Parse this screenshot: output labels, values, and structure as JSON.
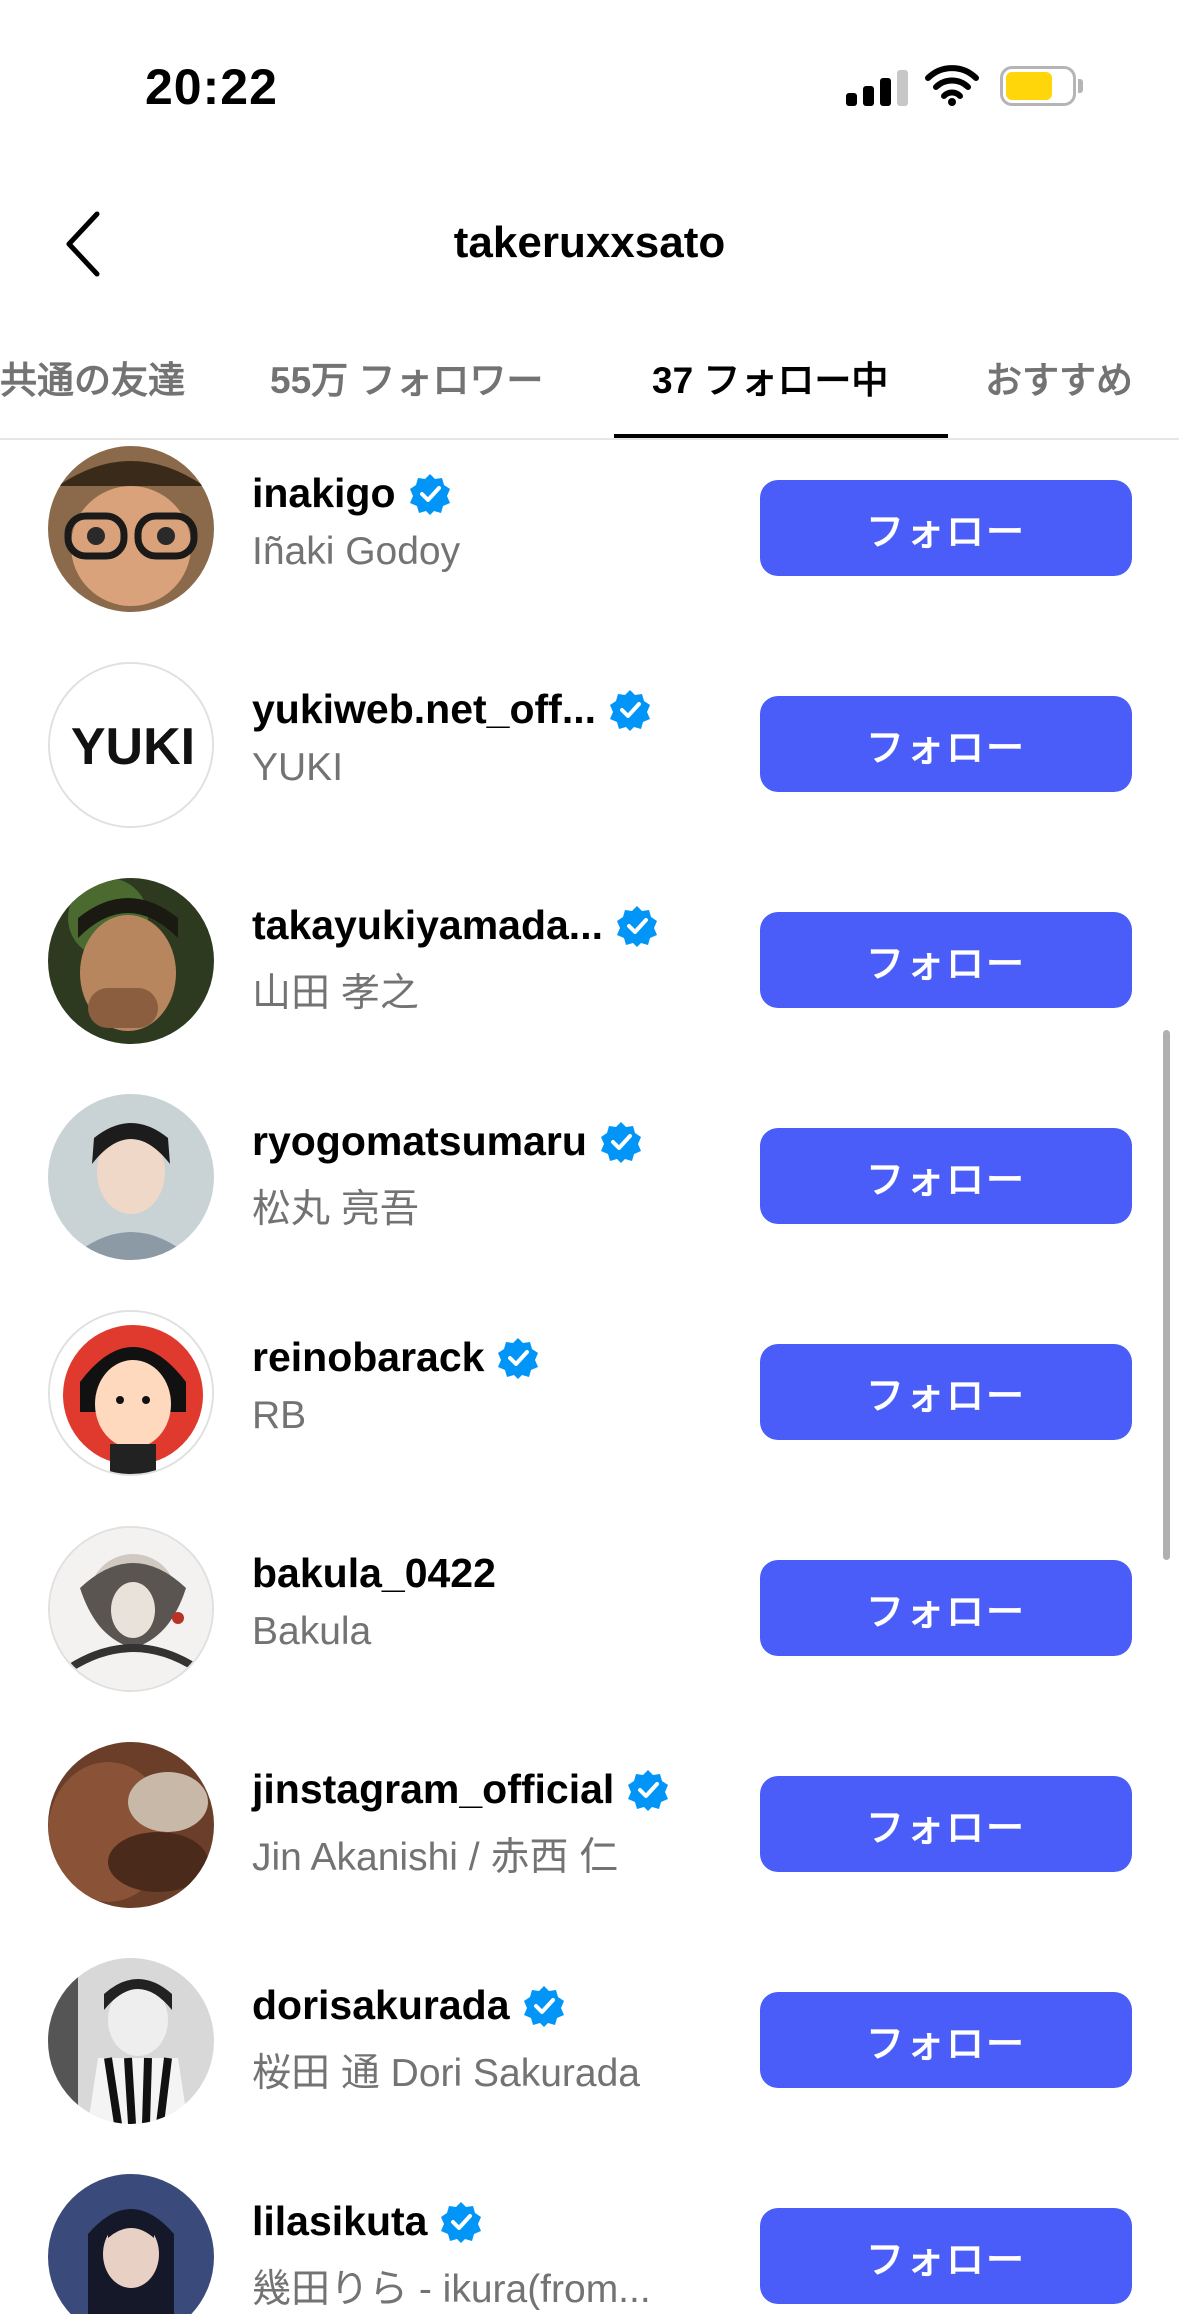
{
  "status_bar": {
    "time": "20:22"
  },
  "header": {
    "title": "takeruxxsato"
  },
  "tabs": [
    {
      "label": "共通の友達"
    },
    {
      "label": "55万 フォロワー"
    },
    {
      "label": "37 フォロー中"
    },
    {
      "label": "おすすめ"
    }
  ],
  "colors": {
    "accent": "#4a5df9",
    "verified": "#0095f6",
    "secondary_text": "#737373"
  },
  "follow_label": "フォロー",
  "accounts": [
    {
      "username": "inakigo",
      "name": "Iñaki Godoy",
      "verified": true
    },
    {
      "username": "yukiweb.net_off...",
      "name": "YUKI",
      "verified": true,
      "avatar_text": "YUKI"
    },
    {
      "username": "takayukiyamada...",
      "name": "山田 孝之",
      "verified": true
    },
    {
      "username": "ryogomatsumaru",
      "name": "松丸 亮吾",
      "verified": true
    },
    {
      "username": "reinobarack",
      "name": "RB",
      "verified": true
    },
    {
      "username": "bakula_0422",
      "name": "Bakula",
      "verified": false
    },
    {
      "username": "jinstagram_official",
      "name": "Jin Akanishi / 赤西 仁",
      "verified": true
    },
    {
      "username": "dorisakurada",
      "name": "桜田 通 Dori Sakurada",
      "verified": true
    },
    {
      "username": "lilasikuta",
      "name": "幾田りら - ikura(from...",
      "verified": true
    }
  ]
}
